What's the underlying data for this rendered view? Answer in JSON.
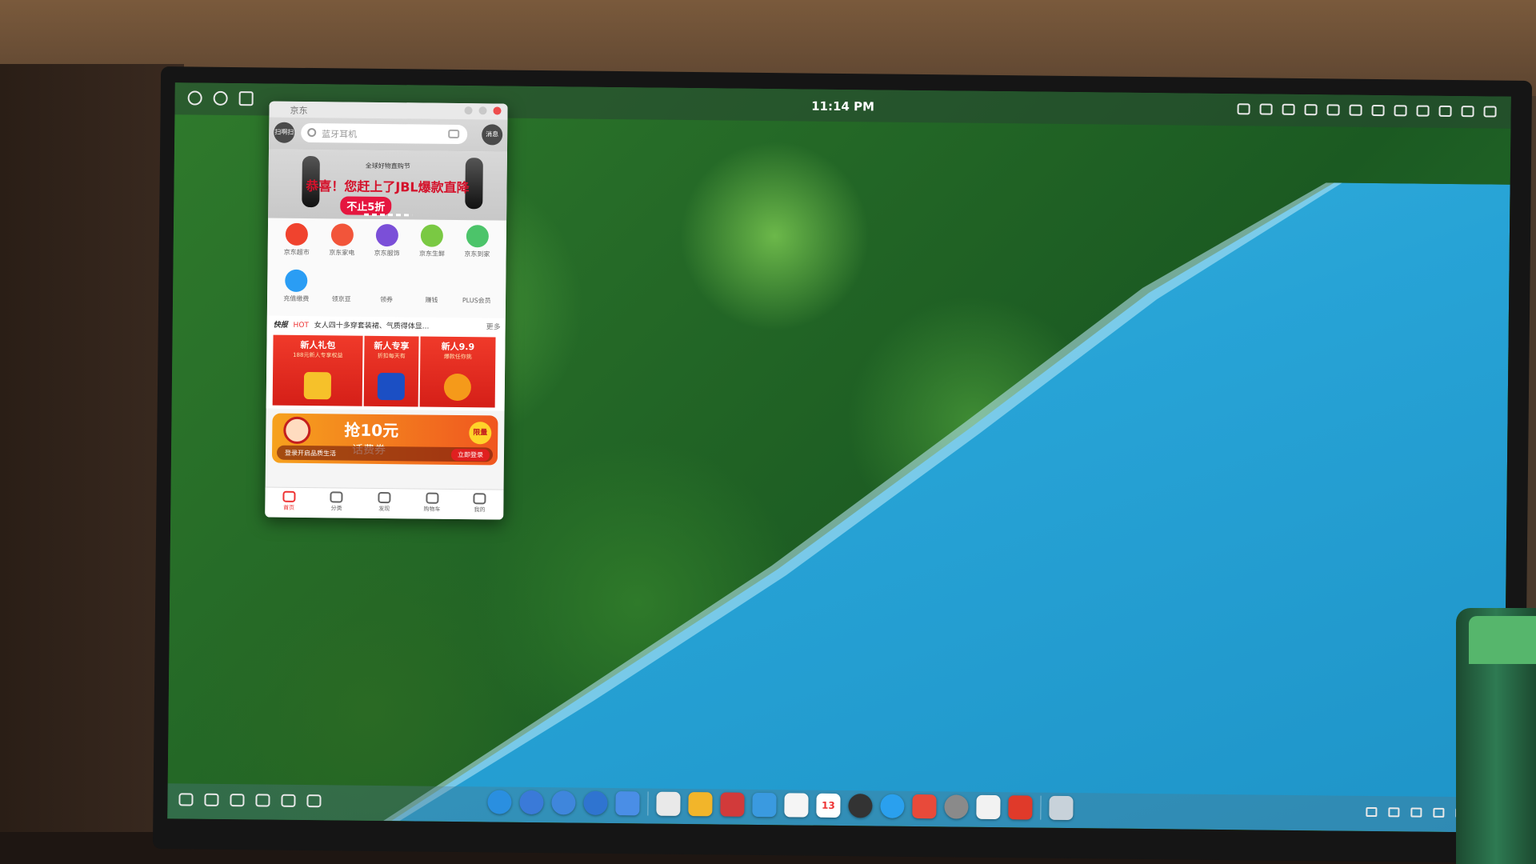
{
  "status_bar": {
    "clock": "11:14 PM",
    "left_icons": [
      "system-menu-icon",
      "browser-icon",
      "screenshot-icon"
    ],
    "right_icons": [
      "display-icon",
      "network-icon",
      "search-icon",
      "record-icon",
      "chevron-right-icon",
      "keyboard-icon",
      "volume-icon",
      "bluetooth-icon",
      "signal-icon",
      "battery-icon",
      "settings-icon",
      "app-grid-icon"
    ]
  },
  "jd_window": {
    "title": "京东",
    "header": {
      "scan_label": "扫啊扫",
      "search_placeholder": "蓝牙耳机",
      "message_label": "消息"
    },
    "banner": {
      "small_text": "全球好物直购节",
      "headline": "恭喜！您赶上了JBL爆款直降",
      "pill": "不止5折"
    },
    "categories": [
      {
        "label": "京东超市",
        "color": "#f0432e"
      },
      {
        "label": "京东家电",
        "color": "#f2553a"
      },
      {
        "label": "京东服饰",
        "color": "#7b4fd8"
      },
      {
        "label": "京东生鲜",
        "color": "#7ac943"
      },
      {
        "label": "京东到家",
        "color": "#4cc46a"
      },
      {
        "label": "充值缴费",
        "color": "#2a9df4"
      },
      {
        "label": "领京豆",
        "color": ""
      },
      {
        "label": "领券",
        "color": ""
      },
      {
        "label": "赚钱",
        "color": ""
      },
      {
        "label": "PLUS会员",
        "color": ""
      }
    ],
    "news": {
      "tag": "快报",
      "hot": "HOT",
      "text": "女人四十多穿套装裙、气质得体显...",
      "more": "更多"
    },
    "promos": [
      {
        "title": "新人礼包",
        "subtitle": "188元新人专享权益"
      },
      {
        "title": "新人专享",
        "subtitle": "折扣每天有"
      },
      {
        "title": "新人9.9",
        "subtitle": "爆款任你挑"
      }
    ],
    "coupon": {
      "amount": "抢10元",
      "subtitle": "话费券",
      "limit": "限量",
      "bar_text": "登录开启品质生活",
      "login": "立即登录"
    },
    "tabs": [
      {
        "label": "首页",
        "active": true
      },
      {
        "label": "分类",
        "active": false
      },
      {
        "label": "发现",
        "active": false
      },
      {
        "label": "购物车",
        "active": false
      },
      {
        "label": "我的",
        "active": false
      }
    ]
  },
  "dock": {
    "left_icons": [
      "launcher-icon",
      "multitask-icon",
      "screen-icon",
      "toggle-icon",
      "lock-icon",
      "chevron-left-icon"
    ],
    "apps": [
      {
        "name": "browser-app-icon",
        "color": "#2a8fe0",
        "round": true
      },
      {
        "name": "files-app-icon",
        "color": "#3a7ad8",
        "round": true
      },
      {
        "name": "windows-app-icon",
        "color": "#3f86dc",
        "round": true
      },
      {
        "name": "screen-app-icon",
        "color": "#2f74d0",
        "round": true
      },
      {
        "name": "grid-app-icon",
        "color": "#4a8ee6",
        "round": false
      },
      {
        "name": "finder-app-icon",
        "color": "#e9e9e9",
        "round": false
      },
      {
        "name": "photos-app-icon",
        "color": "#f2b52a",
        "round": false
      },
      {
        "name": "music-app-icon",
        "color": "#d23a3a",
        "round": false
      },
      {
        "name": "gallery-app-icon",
        "color": "#3a9ae0",
        "round": false
      },
      {
        "name": "notes-app-icon",
        "color": "#f5f5f5",
        "round": false
      },
      {
        "name": "calendar-app-icon",
        "color": "#ffffff",
        "round": false,
        "text": "13"
      },
      {
        "name": "clock-app-icon",
        "color": "#333333",
        "round": true
      },
      {
        "name": "refresh-app-icon",
        "color": "#2aa0ee",
        "round": true
      },
      {
        "name": "store-app-icon",
        "color": "#e84a3a",
        "round": false
      },
      {
        "name": "settings-app-icon",
        "color": "#8a8a8a",
        "round": true
      },
      {
        "name": "cloud-app-icon",
        "color": "#f2f2f2",
        "round": false
      },
      {
        "name": "jd-app-icon",
        "color": "#e03a2a",
        "round": false
      },
      {
        "name": "trash-app-icon",
        "color": "#c8d2da",
        "round": false
      }
    ],
    "right_icons": [
      "chevron-right-icon",
      "tray-icon-1",
      "tray-icon-2",
      "tray-icon-3",
      "tray-icon-4",
      "tray-icon-5"
    ]
  }
}
